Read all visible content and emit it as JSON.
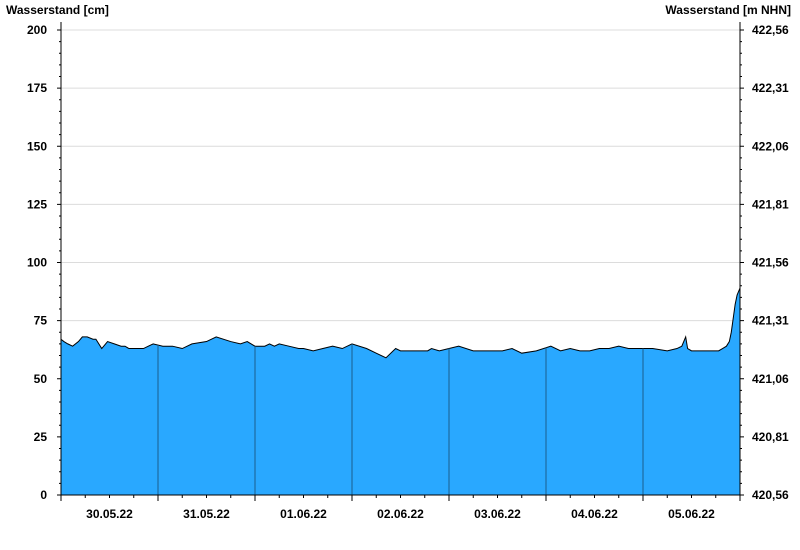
{
  "chart_data": {
    "type": "area",
    "left_axis_label": "Wasserstand [cm]",
    "right_axis_label": "Wasserstand [m NHN]",
    "ylim": [
      0,
      200
    ],
    "y_ticks": [
      0,
      25,
      50,
      75,
      100,
      125,
      150,
      175,
      200
    ],
    "y_tick_labels": [
      "0",
      "25",
      "50",
      "75",
      "100",
      "125",
      "150",
      "175",
      "200"
    ],
    "y2_tick_labels": [
      "420,56",
      "420,81",
      "421,06",
      "421,31",
      "421,56",
      "421,81",
      "422,06",
      "422,31",
      "422,56"
    ],
    "x_day_labels": [
      "30.05.22",
      "31.05.22",
      "01.06.22",
      "02.06.22",
      "03.06.22",
      "04.06.22",
      "05.06.22"
    ],
    "x_range_days": [
      0,
      7
    ],
    "grid": true,
    "fill_color": "#29a8ff",
    "line_color": "#000000",
    "series": [
      {
        "x": [
          0,
          0.03,
          0.07,
          0.12,
          0.18,
          0.22,
          0.27,
          0.33,
          0.36,
          0.42,
          0.48,
          0.55,
          0.62,
          0.66,
          0.7,
          0.72,
          0.76,
          0.8,
          0.85,
          0.9,
          0.95,
          1.05,
          1.15,
          1.25,
          1.35,
          1.5,
          1.6,
          1.75,
          1.85,
          1.92,
          2.0,
          2.1,
          2.15,
          2.2,
          2.25,
          2.35,
          2.45,
          2.5,
          2.6,
          2.7,
          2.8,
          2.9,
          3.0,
          3.15,
          3.25,
          3.35,
          3.45,
          3.5,
          3.55,
          3.62,
          3.67,
          3.7,
          3.73,
          3.75,
          3.78,
          3.82,
          3.9,
          4.0,
          4.1,
          4.25,
          4.35,
          4.45,
          4.55,
          4.65,
          4.75,
          4.9,
          5.05,
          5.15,
          5.25,
          5.35,
          5.4,
          5.45,
          5.55,
          5.65,
          5.75,
          5.85,
          5.95,
          6.1,
          6.25,
          6.35,
          6.4,
          6.44,
          6.46,
          6.5,
          6.6,
          6.7,
          6.78,
          6.82,
          6.86,
          6.89,
          6.91,
          6.93,
          6.95,
          6.97,
          7.0
        ],
        "values": [
          67,
          66,
          65,
          64,
          66,
          68,
          68,
          67,
          67,
          63,
          66,
          65,
          64,
          64,
          63,
          63,
          63,
          63,
          63,
          64,
          65,
          64,
          64,
          63,
          65,
          66,
          68,
          66,
          65,
          66,
          64,
          64,
          65,
          64,
          65,
          64,
          63,
          63,
          62,
          63,
          64,
          63,
          65,
          63,
          61,
          59,
          63,
          62,
          62,
          62,
          62,
          62,
          62,
          62,
          62,
          63,
          62,
          63,
          64,
          62,
          62,
          62,
          62,
          63,
          61,
          62,
          64,
          62,
          63,
          62,
          62,
          62,
          63,
          63,
          64,
          63,
          63,
          63,
          62,
          63,
          64,
          68,
          63,
          62,
          62,
          62,
          62,
          63,
          64,
          66,
          70,
          76,
          82,
          86,
          89
        ]
      }
    ]
  }
}
